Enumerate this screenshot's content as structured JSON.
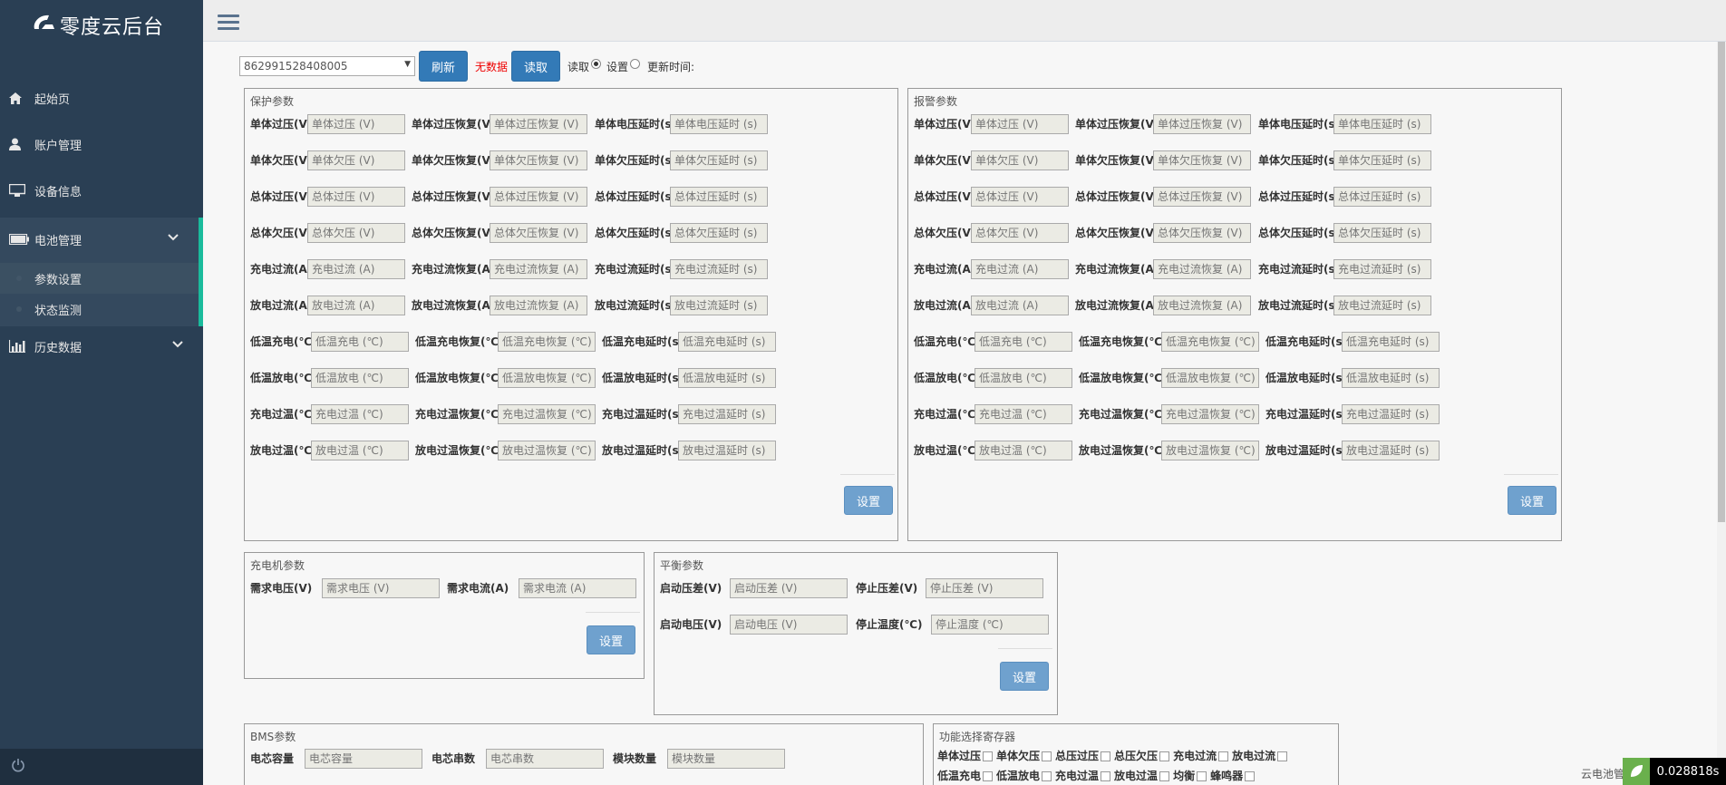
{
  "app": {
    "logo_text": "零度云后台"
  },
  "sidebar": {
    "items": [
      {
        "label": "起始页",
        "icon": "home-icon"
      },
      {
        "label": "账户管理",
        "icon": "user-icon"
      },
      {
        "label": "设备信息",
        "icon": "desktop-icon"
      },
      {
        "label": "电池管理",
        "icon": "battery-icon"
      },
      {
        "label": "历史数据",
        "icon": "bar-chart-icon"
      }
    ],
    "battery_sub": [
      {
        "label": "参数设置"
      },
      {
        "label": "状态监测"
      }
    ]
  },
  "toolbar": {
    "device_id": "862991528408005",
    "refresh_label": "刷新",
    "status_text": "无数据",
    "read_label": "读取",
    "radio_read": "读取",
    "radio_set": "设置",
    "update_time_label": "更新时间:"
  },
  "protect": {
    "title": "保护参数",
    "rows": [
      [
        {
          "label": "单体过压(V)",
          "ph": "单体过压 (V)"
        },
        {
          "label": "单体过压恢复(V)",
          "ph": "单体过压恢复 (V)"
        },
        {
          "label": "单体电压延时(s)",
          "ph": "单体电压延时 (s)"
        }
      ],
      [
        {
          "label": "单体欠压(V)",
          "ph": "单体欠压 (V)"
        },
        {
          "label": "单体欠压恢复(V)",
          "ph": "单体欠压恢复 (V)"
        },
        {
          "label": "单体欠压延时(s)",
          "ph": "单体欠压延时 (s)"
        }
      ],
      [
        {
          "label": "总体过压(V)",
          "ph": "总体过压 (V)"
        },
        {
          "label": "总体过压恢复(V)",
          "ph": "总体过压恢复 (V)"
        },
        {
          "label": "总体过压延时(s)",
          "ph": "总体过压延时 (s)"
        }
      ],
      [
        {
          "label": "总体欠压(V)",
          "ph": "总体欠压 (V)"
        },
        {
          "label": "总体欠压恢复(V)",
          "ph": "总体欠压恢复 (V)"
        },
        {
          "label": "总体欠压延时(s)",
          "ph": "总体欠压延时 (s)"
        }
      ],
      [
        {
          "label": "充电过流(A)",
          "ph": "充电过流 (A)"
        },
        {
          "label": "充电过流恢复(A)",
          "ph": "充电过流恢复 (A)"
        },
        {
          "label": "充电过流延时(s)",
          "ph": "充电过流延时 (s)"
        }
      ],
      [
        {
          "label": "放电过流(A)",
          "ph": "放电过流 (A)"
        },
        {
          "label": "放电过流恢复(A)",
          "ph": "放电过流恢复 (A)"
        },
        {
          "label": "放电过流延时(s)",
          "ph": "放电过流延时 (s)"
        }
      ],
      [
        {
          "label": "低温充电(℃)",
          "ph": "低温充电 (℃)"
        },
        {
          "label": "低温充电恢复(℃)",
          "ph": "低温充电恢复 (℃)"
        },
        {
          "label": "低温充电延时(s)",
          "ph": "低温充电延时 (s)"
        }
      ],
      [
        {
          "label": "低温放电(℃)",
          "ph": "低温放电 (℃)"
        },
        {
          "label": "低温放电恢复(℃)",
          "ph": "低温放电恢复 (℃)"
        },
        {
          "label": "低温放电延时(s)",
          "ph": "低温放电延时 (s)"
        }
      ],
      [
        {
          "label": "充电过温(℃)",
          "ph": "充电过温 (℃)"
        },
        {
          "label": "充电过温恢复(℃)",
          "ph": "充电过温恢复 (℃)"
        },
        {
          "label": "充电过温延时(s)",
          "ph": "充电过温延时 (s)"
        }
      ],
      [
        {
          "label": "放电过温(℃)",
          "ph": "放电过温 (℃)"
        },
        {
          "label": "放电过温恢复(℃)",
          "ph": "放电过温恢复 (℃)"
        },
        {
          "label": "放电过温延时(s)",
          "ph": "放电过温延时 (s)"
        }
      ]
    ],
    "set_label": "设置"
  },
  "alarm": {
    "title": "报警参数",
    "rows": [
      [
        {
          "label": "单体过压(V)",
          "ph": "单体过压 (V)"
        },
        {
          "label": "单体过压恢复(V)",
          "ph": "单体过压恢复 (V)"
        },
        {
          "label": "单体电压延时(s)",
          "ph": "单体电压延时 (s)"
        }
      ],
      [
        {
          "label": "单体欠压(V)",
          "ph": "单体欠压 (V)"
        },
        {
          "label": "单体欠压恢复(V)",
          "ph": "单体欠压恢复 (V)"
        },
        {
          "label": "单体欠压延时(s)",
          "ph": "单体欠压延时 (s)"
        }
      ],
      [
        {
          "label": "总体过压(V)",
          "ph": "总体过压 (V)"
        },
        {
          "label": "总体过压恢复(V)",
          "ph": "总体过压恢复 (V)"
        },
        {
          "label": "总体过压延时(s)",
          "ph": "总体过压延时 (s)"
        }
      ],
      [
        {
          "label": "总体欠压(V)",
          "ph": "总体欠压 (V)"
        },
        {
          "label": "总体欠压恢复(V)",
          "ph": "总体欠压恢复 (V)"
        },
        {
          "label": "总体欠压延时(s)",
          "ph": "总体欠压延时 (s)"
        }
      ],
      [
        {
          "label": "充电过流(A)",
          "ph": "充电过流 (A)"
        },
        {
          "label": "充电过流恢复(A)",
          "ph": "充电过流恢复 (A)"
        },
        {
          "label": "充电过流延时(s)",
          "ph": "充电过流延时 (s)"
        }
      ],
      [
        {
          "label": "放电过流(A)",
          "ph": "放电过流 (A)"
        },
        {
          "label": "放电过流恢复(A)",
          "ph": "放电过流恢复 (A)"
        },
        {
          "label": "放电过流延时(s)",
          "ph": "放电过流延时 (s)"
        }
      ],
      [
        {
          "label": "低温充电(℃)",
          "ph": "低温充电 (℃)"
        },
        {
          "label": "低温充电恢复(℃)",
          "ph": "低温充电恢复 (℃)"
        },
        {
          "label": "低温充电延时(s)",
          "ph": "低温充电延时 (s)"
        }
      ],
      [
        {
          "label": "低温放电(℃)",
          "ph": "低温放电 (℃)"
        },
        {
          "label": "低温放电恢复(℃)",
          "ph": "低温放电恢复 (℃)"
        },
        {
          "label": "低温放电延时(s)",
          "ph": "低温放电延时 (s)"
        }
      ],
      [
        {
          "label": "充电过温(℃)",
          "ph": "充电过温 (℃)"
        },
        {
          "label": "充电过温恢复(℃)",
          "ph": "充电过温恢复 (℃)"
        },
        {
          "label": "充电过温延时(s)",
          "ph": "充电过温延时 (s)"
        }
      ],
      [
        {
          "label": "放电过温(℃)",
          "ph": "放电过温 (℃)"
        },
        {
          "label": "放电过温恢复(℃)",
          "ph": "放电过温恢复 (℃)"
        },
        {
          "label": "放电过温延时(s)",
          "ph": "放电过温延时 (s)"
        }
      ]
    ],
    "set_label": "设置"
  },
  "charger": {
    "title": "充电机参数",
    "fields": [
      {
        "label": "需求电压(V)",
        "ph": "需求电压 (V)"
      },
      {
        "label": "需求电流(A)",
        "ph": "需求电流 (A)"
      }
    ],
    "set_label": "设置"
  },
  "balance": {
    "title": "平衡参数",
    "fields": [
      {
        "label": "启动压差(V)",
        "ph": "启动压差 (V)"
      },
      {
        "label": "停止压差(V)",
        "ph": "停止压差 (V)"
      },
      {
        "label": "启动电压(V)",
        "ph": "启动电压 (V)"
      },
      {
        "label": "停止温度(℃)",
        "ph": "停止温度 (℃)"
      }
    ],
    "set_label": "设置"
  },
  "bms": {
    "title": "BMS参数",
    "fields": [
      {
        "label": "电芯容量",
        "ph": "电芯容量"
      },
      {
        "label": "电芯串数",
        "ph": "电芯串数"
      },
      {
        "label": "模块数量",
        "ph": "模块数量"
      }
    ]
  },
  "funcsel": {
    "title": "功能选择寄存器",
    "options": [
      "单体过压",
      "单体欠压",
      "总压过压",
      "总压欠压",
      "充电过流",
      "放电过流"
    ],
    "options2": [
      "低温充电",
      "低温放电",
      "充电过温",
      "放电过温",
      "均衡",
      "蜂鸣器"
    ]
  },
  "footer": {
    "corner_text": "云电池管理",
    "timer": "0.028818s"
  }
}
